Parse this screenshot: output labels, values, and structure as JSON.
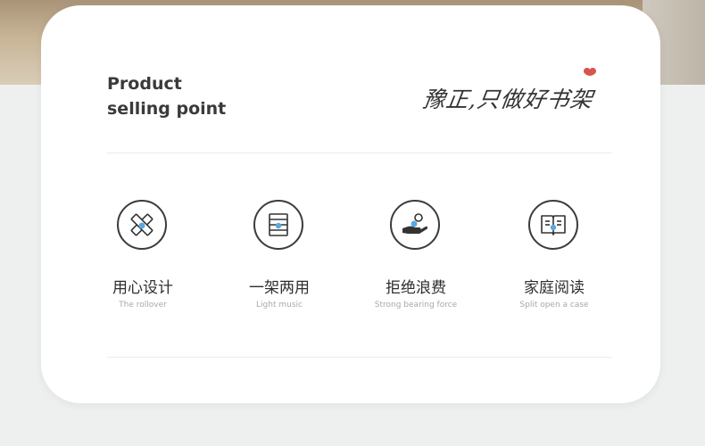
{
  "heading": {
    "line1": "Product",
    "line2": "selling point"
  },
  "slogan": "豫正,只做好书架",
  "colors": {
    "accent": "#d9534f",
    "icon_fill": "#5aa8e0"
  },
  "features": [
    {
      "title": "用心设计",
      "subtitle": "The rollover",
      "icon": "ruler-pencil-icon"
    },
    {
      "title": "一架两用",
      "subtitle": "Light music",
      "icon": "shelf-icon"
    },
    {
      "title": "拒绝浪费",
      "subtitle": "Strong bearing force",
      "icon": "hand-coin-icon"
    },
    {
      "title": "家庭阅读",
      "subtitle": "Split open a case",
      "icon": "open-book-icon"
    }
  ]
}
